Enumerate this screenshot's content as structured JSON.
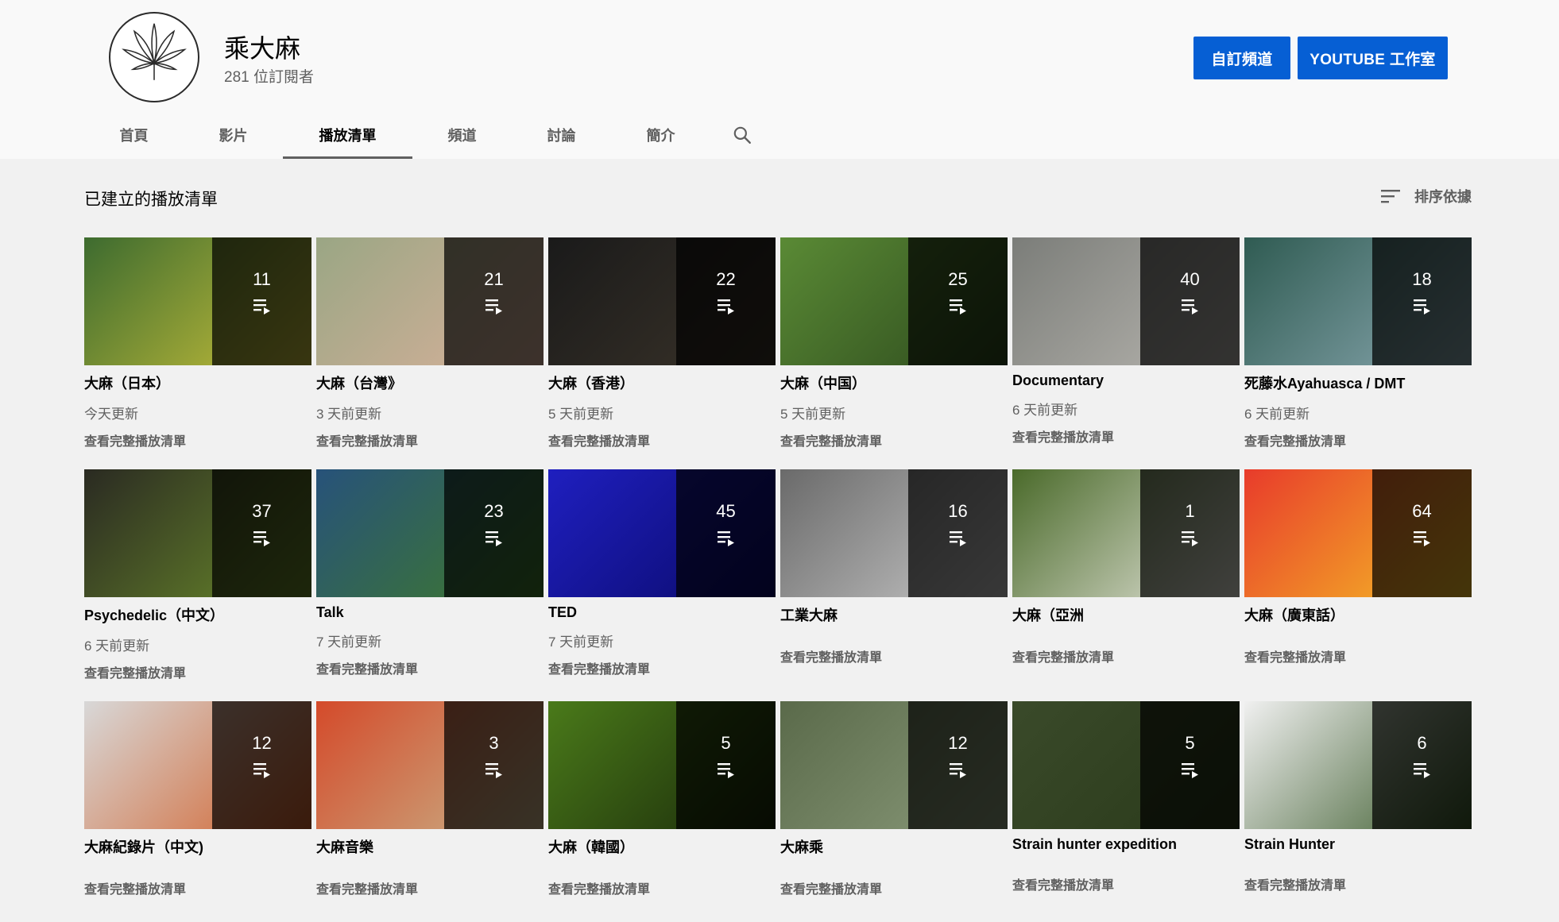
{
  "channel": {
    "name": "乘大麻",
    "subscribers": "281 位訂閱者"
  },
  "buttons": {
    "customize": "自訂頻道",
    "studio": "YOUTUBE 工作室"
  },
  "tabs": [
    {
      "label": "首頁",
      "active": false
    },
    {
      "label": "影片",
      "active": false
    },
    {
      "label": "播放清單",
      "active": true
    },
    {
      "label": "頻道",
      "active": false
    },
    {
      "label": "討論",
      "active": false
    },
    {
      "label": "簡介",
      "active": false
    }
  ],
  "section": {
    "title": "已建立的播放清單",
    "sort_label": "排序依據"
  },
  "view_full_label": "查看完整播放清單",
  "playlists": [
    {
      "title": "大麻（日本）",
      "count": "11",
      "updated": "今天更新",
      "colors": [
        "#3d6b2f",
        "#c9c13a"
      ]
    },
    {
      "title": "大麻（台灣》",
      "count": "21",
      "updated": "3 天前更新",
      "colors": [
        "#9aa684",
        "#d9b19b"
      ]
    },
    {
      "title": "大麻（香港）",
      "count": "22",
      "updated": "5 天前更新",
      "colors": [
        "#1a1a1a",
        "#3a3329"
      ]
    },
    {
      "title": "大麻（中国）",
      "count": "25",
      "updated": "5 天前更新",
      "colors": [
        "#5a8a35",
        "#2d4a1d"
      ]
    },
    {
      "title": "Documentary",
      "count": "40",
      "updated": "6 天前更新",
      "colors": [
        "#7b7d79",
        "#b8b6b0"
      ]
    },
    {
      "title": "死藤水Ayahuasca / DMT",
      "count": "18",
      "updated": "6 天前更新",
      "colors": [
        "#2f5b52",
        "#8aa8b0"
      ]
    },
    {
      "title": "Psychedelic（中文）",
      "count": "37",
      "updated": "6 天前更新",
      "colors": [
        "#2a2a22",
        "#6a8a2a"
      ]
    },
    {
      "title": "Talk",
      "count": "23",
      "updated": "7 天前更新",
      "colors": [
        "#27527a",
        "#3f7a2a"
      ]
    },
    {
      "title": "TED",
      "count": "45",
      "updated": "7 天前更新",
      "colors": [
        "#1f1fbf",
        "#0a0a6a"
      ]
    },
    {
      "title": "工業大麻",
      "count": "16",
      "updated": "",
      "colors": [
        "#6a6a6a",
        "#c8c8c8"
      ]
    },
    {
      "title": "大麻（亞洲",
      "count": "1",
      "updated": "",
      "colors": [
        "#4a6a2a",
        "#e6e6dc"
      ]
    },
    {
      "title": "大麻（廣東話）",
      "count": "64",
      "updated": "",
      "colors": [
        "#e83b2b",
        "#f5c026"
      ]
    },
    {
      "title": "大麻紀錄片（中文)",
      "count": "12",
      "updated": "",
      "colors": [
        "#d8d8d8",
        "#d1602a"
      ]
    },
    {
      "title": "大麻音樂",
      "count": "3",
      "updated": "",
      "colors": [
        "#d44a2a",
        "#c8b48a"
      ]
    },
    {
      "title": "大麻（韓國）",
      "count": "5",
      "updated": "",
      "colors": [
        "#4a7a1a",
        "#1a2a0a"
      ]
    },
    {
      "title": "大麻乘",
      "count": "12",
      "updated": "",
      "colors": [
        "#5a6a4a",
        "#8a9a7a"
      ]
    },
    {
      "title": "Strain hunter expedition",
      "count": "5",
      "updated": "",
      "colors": [
        "#3a4a2a",
        "#2a3a1a"
      ]
    },
    {
      "title": "Strain Hunter",
      "count": "6",
      "updated": "",
      "colors": [
        "#f0f0f0",
        "#3a5a2a"
      ]
    }
  ]
}
